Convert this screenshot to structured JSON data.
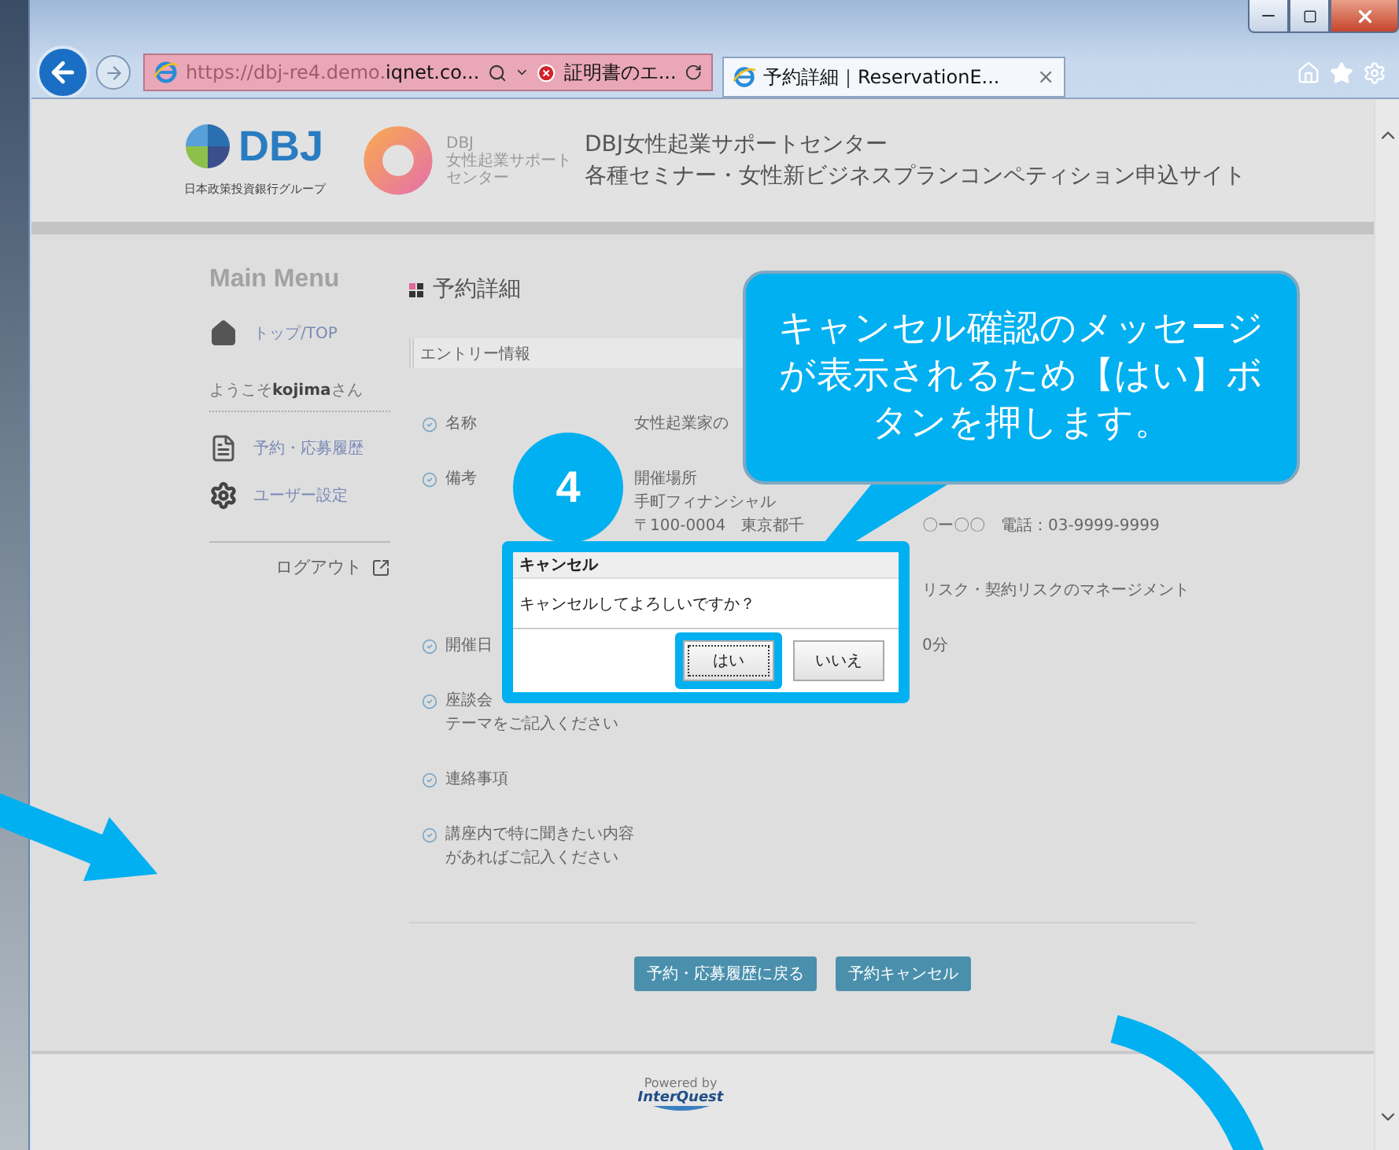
{
  "browser": {
    "url_host": "https://dbj-re4.demo.",
    "url_domain": "iqnet.co...",
    "cert_error": "証明書のエ...",
    "tabs": [
      {
        "title": "予約詳細｜ReservationE...",
        "close": "×",
        "selected": true
      }
    ]
  },
  "header": {
    "logo_text": "DBJ",
    "logo_caption": "日本政策投資銀行グループ",
    "emblem_caption": [
      "DBJ",
      "女性起業サポート",
      "センター"
    ],
    "title_lines": [
      "DBJ女性起業サポートセンター",
      "各種セミナー・女性新ビジネスプランコンペティション申込サイト"
    ]
  },
  "sidebar": {
    "heading": "Main Menu",
    "items": [
      {
        "kind": "home",
        "label": "トップ/TOP"
      }
    ],
    "welcome": "ようこそ**kojima**さん",
    "user_items": [
      {
        "kind": "history",
        "label": "予約・応募履歴"
      },
      {
        "kind": "settings",
        "label": "ユーザー設定"
      }
    ],
    "logout": "ログアウト"
  },
  "main": {
    "title": "予約詳細",
    "section": "エントリー情報",
    "rows": [
      {
        "label_lines": [
          "名称"
        ],
        "lines": [
          {
            "kind": "left",
            "segments": [
              "女性起業家の"
            ]
          }
        ]
      },
      {
        "label_lines": [
          "備考"
        ],
        "lines": [
          {
            "kind": "left",
            "segments": [
              "開催場所"
            ]
          },
          {
            "kind": "left",
            "segments": [
              "手町フィナンシャル"
            ]
          },
          {
            "kind": "split",
            "segments": [
              "〒100-0004　東京都千",
              "〇ー〇〇　電話：03-9999-9999"
            ]
          },
          {
            "kind": "right",
            "segments": [
              "リスク・契約リスクのマネージメント"
            ]
          }
        ]
      },
      {
        "label_lines": [
          "開催日"
        ],
        "lines": [
          {
            "kind": "right",
            "segments": [
              "0分"
            ]
          }
        ]
      },
      {
        "label_lines": [
          "座談会",
          "テーマをご記入ください"
        ],
        "lines": []
      },
      {
        "label_lines": [
          "連絡事項"
        ],
        "lines": []
      },
      {
        "label_lines": [
          "講座内で特に聞きたい内容",
          "があればご記入ください"
        ],
        "lines": []
      }
    ],
    "buttons": [
      "予約・応募履歴に戻る",
      "予約キャンセル"
    ]
  },
  "footer": {
    "powered_by": "Powered by",
    "brand": "InterQuest"
  },
  "dialog": {
    "title": "キャンセル",
    "message": "キャンセルしてよろしいですか？",
    "buttons": [
      {
        "label": "はい",
        "focused": true,
        "highlighted": true
      },
      {
        "label": "いいえ",
        "focused": false,
        "highlighted": false
      }
    ]
  },
  "annotation": {
    "step": "4",
    "callout": "キャンセル確認のメッセージが表示されるため【はい】ボタンを押します。"
  }
}
